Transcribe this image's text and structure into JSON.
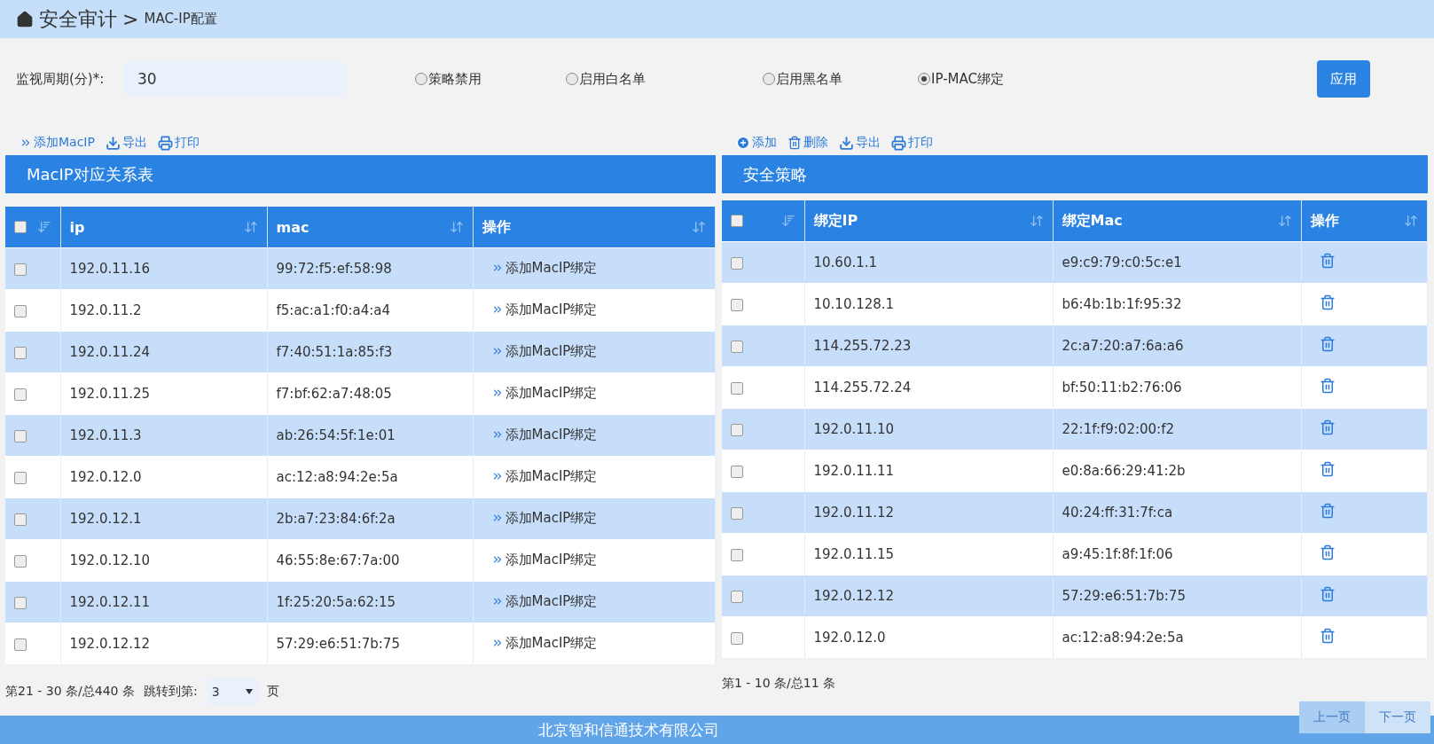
{
  "breadcrumb": {
    "root": "安全审计",
    "separator": ">",
    "current": "MAC-IP配置"
  },
  "monitor": {
    "label": "监视周期(分)*:",
    "value": "30"
  },
  "modes": [
    {
      "label": "策略禁用",
      "selected": false
    },
    {
      "label": "启用白名单",
      "selected": false
    },
    {
      "label": "启用黑名单",
      "selected": false
    },
    {
      "label": "IP-MAC绑定",
      "selected": true
    }
  ],
  "apply_button": "应用",
  "left_toolbar": [
    {
      "kind": "link",
      "label": "添加MacIP"
    },
    {
      "kind": "export",
      "label": "导出"
    },
    {
      "kind": "print",
      "label": "打印"
    }
  ],
  "right_toolbar": [
    {
      "kind": "add",
      "label": "添加"
    },
    {
      "kind": "delete",
      "label": "删除"
    },
    {
      "kind": "export",
      "label": "导出"
    },
    {
      "kind": "print",
      "label": "打印"
    }
  ],
  "left_panel": {
    "title": "MacIP对应关系表",
    "select_all_checked": false,
    "columns": [
      "ip",
      "mac",
      "操作"
    ],
    "rows": [
      {
        "checked": false,
        "ip": "192.0.11.16",
        "mac": "99:72:f5:ef:58:98",
        "action": "添加MacIP绑定"
      },
      {
        "checked": false,
        "ip": "192.0.11.2",
        "mac": "f5:ac:a1:f0:a4:a4",
        "action": "添加MacIP绑定"
      },
      {
        "checked": false,
        "ip": "192.0.11.24",
        "mac": "f7:40:51:1a:85:f3",
        "action": "添加MacIP绑定"
      },
      {
        "checked": false,
        "ip": "192.0.11.25",
        "mac": "f7:bf:62:a7:48:05",
        "action": "添加MacIP绑定"
      },
      {
        "checked": false,
        "ip": "192.0.11.3",
        "mac": "ab:26:54:5f:1e:01",
        "action": "添加MacIP绑定"
      },
      {
        "checked": false,
        "ip": "192.0.12.0",
        "mac": "ac:12:a8:94:2e:5a",
        "action": "添加MacIP绑定"
      },
      {
        "checked": false,
        "ip": "192.0.12.1",
        "mac": "2b:a7:23:84:6f:2a",
        "action": "添加MacIP绑定"
      },
      {
        "checked": false,
        "ip": "192.0.12.10",
        "mac": "46:55:8e:67:7a:00",
        "action": "添加MacIP绑定"
      },
      {
        "checked": false,
        "ip": "192.0.12.11",
        "mac": "1f:25:20:5a:62:15",
        "action": "添加MacIP绑定"
      },
      {
        "checked": false,
        "ip": "192.0.12.12",
        "mac": "57:29:e6:51:7b:75",
        "action": "添加MacIP绑定"
      }
    ],
    "summary": "第21 - 30 条/总440 条",
    "jump_label": "跳转到第:",
    "page_select": "3",
    "page_suffix": "页"
  },
  "right_panel": {
    "title": "安全策略",
    "select_all_checked": false,
    "columns": [
      "绑定IP",
      "绑定Mac",
      "操作"
    ],
    "rows": [
      {
        "checked": false,
        "ip": "10.60.1.1",
        "mac": "e9:c9:79:c0:5c:e1"
      },
      {
        "checked": false,
        "ip": "10.10.128.1",
        "mac": "b6:4b:1b:1f:95:32"
      },
      {
        "checked": false,
        "ip": "114.255.72.23",
        "mac": "2c:a7:20:a7:6a:a6"
      },
      {
        "checked": false,
        "ip": "114.255.72.24",
        "mac": "bf:50:11:b2:76:06"
      },
      {
        "checked": false,
        "ip": "192.0.11.10",
        "mac": "22:1f:f9:02:00:f2"
      },
      {
        "checked": false,
        "ip": "192.0.11.11",
        "mac": "e0:8a:66:29:41:2b"
      },
      {
        "checked": false,
        "ip": "192.0.11.12",
        "mac": "40:24:ff:31:7f:ca"
      },
      {
        "checked": false,
        "ip": "192.0.11.15",
        "mac": "a9:45:1f:8f:1f:06"
      },
      {
        "checked": false,
        "ip": "192.0.12.12",
        "mac": "57:29:e6:51:7b:75"
      },
      {
        "checked": false,
        "ip": "192.0.12.0",
        "mac": "ac:12:a8:94:2e:5a"
      }
    ],
    "summary": "第1 - 10 条/总11 条",
    "buttons": [
      "上一页",
      "下一页"
    ]
  },
  "footer": "北京智和信通技术有限公司"
}
